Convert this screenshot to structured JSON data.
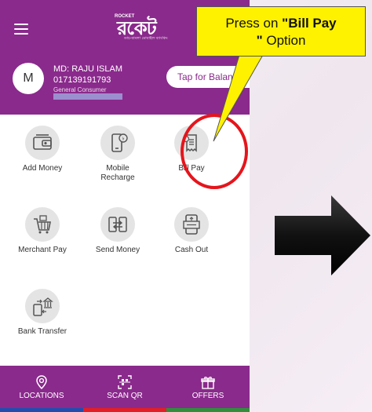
{
  "app": {
    "logo_small": "ROCKET",
    "logo_main": "রকেট",
    "logo_tagline": "ডাচ-বাংলা মোবাইল ব্যাংকিং"
  },
  "user": {
    "initial": "M",
    "name": "MD: RAJU ISLAM",
    "phone": "017139191793",
    "type": "General Consumer"
  },
  "balance_button": {
    "label": "Tap for Balance"
  },
  "services": [
    {
      "label": "Add Money",
      "icon": "wallet-icon"
    },
    {
      "label": "Mobile Recharge",
      "label_line1": "Mobile",
      "label_line2": "Recharge",
      "icon": "mobile-recharge-icon"
    },
    {
      "label": "Bill Pay",
      "icon": "bill-pay-icon"
    },
    {
      "label": "Merchant Pay",
      "icon": "shopping-cart-icon"
    },
    {
      "label": "Send Money",
      "icon": "send-money-icon"
    },
    {
      "label": "Cash Out",
      "icon": "cash-out-icon"
    },
    {
      "label": "Bank Transfer",
      "icon": "bank-transfer-icon"
    }
  ],
  "bottom_nav": [
    {
      "label": "LOCATIONS",
      "icon": "location-pin-icon",
      "bar_color": "#1e4fae"
    },
    {
      "label": "SCAN QR",
      "icon": "scan-qr-icon",
      "bar_color": "#e31e24"
    },
    {
      "label": "OFFERS",
      "icon": "gift-icon",
      "bar_color": "#2f8f3a"
    }
  ],
  "annotation": {
    "prefix": "Press on ",
    "emphasis": "\"Bill Pay",
    "line2_quote": "\"",
    "line2_rest": " Option"
  },
  "colors": {
    "brand_purple": "#8a2a8c",
    "callout_yellow": "#fff200",
    "highlight_red": "#e5151c",
    "tile_gray": "#e4e4e4"
  }
}
